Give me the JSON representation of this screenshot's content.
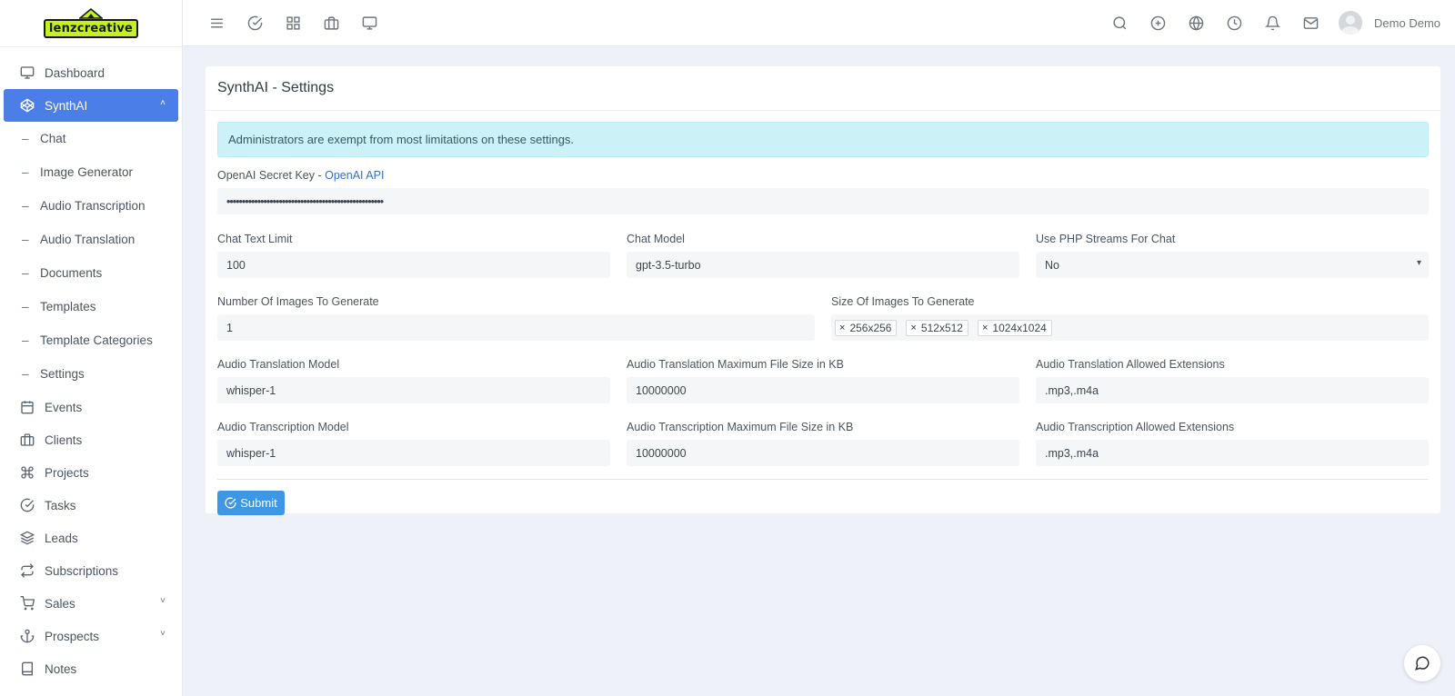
{
  "brand": {
    "logo_text": "lenzcreative",
    "accent": "#c5f21a"
  },
  "sidebar": {
    "items": [
      {
        "label": "Dashboard",
        "icon": "monitor-icon"
      },
      {
        "label": "SynthAI",
        "icon": "codepen-icon",
        "active": true
      },
      {
        "label": "Events",
        "icon": "calendar-icon"
      },
      {
        "label": "Clients",
        "icon": "briefcase-icon"
      },
      {
        "label": "Projects",
        "icon": "command-icon"
      },
      {
        "label": "Tasks",
        "icon": "check-circle-icon"
      },
      {
        "label": "Leads",
        "icon": "layers-icon"
      },
      {
        "label": "Subscriptions",
        "icon": "repeat-icon"
      },
      {
        "label": "Sales",
        "icon": "cart-icon"
      },
      {
        "label": "Prospects",
        "icon": "anchor-icon"
      },
      {
        "label": "Notes",
        "icon": "book-icon"
      }
    ],
    "subitems": [
      {
        "label": "Chat"
      },
      {
        "label": "Image Generator"
      },
      {
        "label": "Audio Transcription"
      },
      {
        "label": "Audio Translation"
      },
      {
        "label": "Documents"
      },
      {
        "label": "Templates"
      },
      {
        "label": "Template Categories"
      },
      {
        "label": "Settings"
      }
    ]
  },
  "topbar": {
    "user_name": "Demo Demo"
  },
  "card": {
    "title": "SynthAI - Settings",
    "alert": "Administrators are exempt from most limitations on these settings.",
    "secret_key": {
      "label": "OpenAI Secret Key -",
      "link": "OpenAI API",
      "value": "•••••••••••••••••••••••••••••••••••••••••••••••••••"
    },
    "chat_text_limit": {
      "label": "Chat Text Limit",
      "value": "100"
    },
    "chat_model": {
      "label": "Chat Model",
      "value": "gpt-3.5-turbo"
    },
    "php_streams": {
      "label": "Use PHP Streams For Chat",
      "value": "No"
    },
    "num_images": {
      "label": "Number Of Images To Generate",
      "value": "1"
    },
    "image_sizes": {
      "label": "Size Of Images To Generate",
      "tags": [
        "256x256",
        "512x512",
        "1024x1024"
      ]
    },
    "tr_model": {
      "label": "Audio Translation Model",
      "value": "whisper-1"
    },
    "tr_max": {
      "label": "Audio Translation Maximum File Size in KB",
      "value": "10000000"
    },
    "tr_ext": {
      "label": "Audio Translation Allowed Extensions",
      "value": ".mp3,.m4a"
    },
    "ts_model": {
      "label": "Audio Transcription Model",
      "value": "whisper-1"
    },
    "ts_max": {
      "label": "Audio Transcription Maximum File Size in KB",
      "value": "10000000"
    },
    "ts_ext": {
      "label": "Audio Transcription Allowed Extensions",
      "value": ".mp3,.m4a"
    },
    "submit_label": "Submit"
  }
}
